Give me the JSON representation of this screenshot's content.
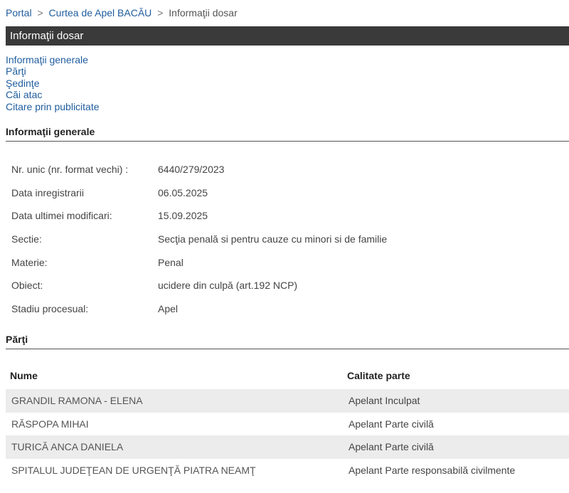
{
  "breadcrumb": {
    "items": [
      "Portal",
      "Curtea de Apel BACĂU",
      "Informaţii dosar"
    ],
    "separator": ">"
  },
  "title": "Informaţii dosar",
  "toc": [
    "Informaţii generale",
    "Părţi",
    "Şedinţe",
    "Căi atac",
    "Citare prin publicitate"
  ],
  "general": {
    "heading": "Informaţii generale",
    "rows": [
      {
        "label": "Nr. unic (nr. format vechi) :",
        "value": "6440/279/2023"
      },
      {
        "label": "Data inregistrarii",
        "value": "06.05.2025"
      },
      {
        "label": "Data ultimei modificari:",
        "value": "15.09.2025"
      },
      {
        "label": "Sectie:",
        "value": "Secţia penală si pentru cauze cu minori si de familie"
      },
      {
        "label": "Materie:",
        "value": "Penal"
      },
      {
        "label": "Obiect:",
        "value": "ucidere din culpă (art.192 NCP)"
      },
      {
        "label": "Stadiu procesual:",
        "value": "Apel"
      }
    ]
  },
  "parti": {
    "heading": "Părţi",
    "columns": [
      "Nume",
      "Calitate parte"
    ],
    "rows": [
      {
        "nume": "GRANDIL RAMONA - ELENA",
        "calitate": "Apelant Inculpat"
      },
      {
        "nume": "RĂSPOPA MIHAI",
        "calitate": "Apelant Parte civilă"
      },
      {
        "nume": "TURICĂ ANCA DANIELA",
        "calitate": "Apelant Parte civilă"
      },
      {
        "nume": "SPITALUL JUDEŢEAN DE URGENŢĂ PIATRA NEAMŢ",
        "calitate": "Apelant Parte responsabilă civilmente"
      }
    ]
  },
  "colors": {
    "titlebar_bg": "#3a3a3a",
    "link": "#1f5d9e",
    "row_alt": "#ececec"
  }
}
